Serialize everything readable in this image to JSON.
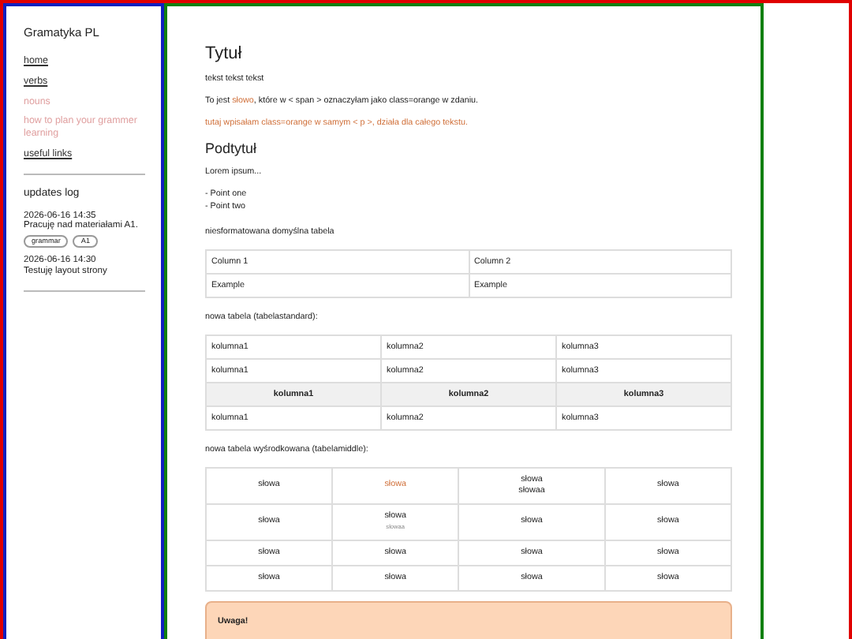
{
  "sidebar": {
    "site_title": "Gramatyka PL",
    "nav": [
      {
        "label": "home",
        "disabled": false
      },
      {
        "label": "verbs",
        "disabled": false
      },
      {
        "label": "nouns",
        "disabled": true
      },
      {
        "label": "how to plan your grammer learning",
        "disabled": true
      },
      {
        "label": "useful links",
        "disabled": false
      }
    ],
    "updates_title": "updates log",
    "updates": [
      {
        "time": "2026-06-16 14:35",
        "text": "Pracuję nad materiałami A1.",
        "tags": [
          "grammar",
          "A1"
        ]
      },
      {
        "time": "2026-06-16 14:30",
        "text": "Testuję layout strony"
      }
    ]
  },
  "main": {
    "title": "Tytuł",
    "paragraphs": [
      {
        "parts": [
          {
            "text": "tekst tekst tekst",
            "orange": false
          }
        ]
      },
      {
        "parts": [
          {
            "text": "To jest ",
            "orange": false
          },
          {
            "text": "słowo",
            "orange": true
          },
          {
            "text": ", które w < span > oznaczyłam jako class=orange w zdaniu.",
            "orange": false
          }
        ]
      },
      {
        "parts": [
          {
            "text": "tutaj wpisałam class=orange w samym < p >, działa dla całego tekstu.",
            "orange": true
          }
        ]
      }
    ],
    "subtitle": "Podtytuł",
    "lorem": "Lorem ipsum...",
    "points": [
      "- Point one",
      "- Point two"
    ],
    "table1_caption": "niesformatowana domyślna tabela",
    "table1": [
      [
        "Column 1",
        "Column 2"
      ],
      [
        "Example",
        "Example"
      ]
    ],
    "table2_caption": "nowa tabela (tabelastandard):",
    "table2": [
      {
        "kind": "normal",
        "cells": [
          "kolumna1",
          "kolumna2",
          "kolumna3"
        ]
      },
      {
        "kind": "normal",
        "cells": [
          "kolumna1",
          "kolumna2",
          "kolumna3"
        ]
      },
      {
        "kind": "header",
        "cells": [
          "kolumna1",
          "kolumna2",
          "kolumna3"
        ]
      },
      {
        "kind": "normal",
        "cells": [
          "kolumna1",
          "kolumna2",
          "kolumna3"
        ]
      }
    ],
    "table3_caption": "nowa tabela wyśrodkowana (tabelamiddle):",
    "table3": [
      [
        {
          "text": "słowa"
        },
        {
          "text": "słowa",
          "orange": true
        },
        {
          "text": "słowa",
          "second_line": "słowaa"
        },
        {
          "text": "słowa"
        }
      ],
      [
        {
          "text": "słowa"
        },
        {
          "text": "słowa",
          "note": "słowaa"
        },
        {
          "text": "słowa"
        },
        {
          "text": "słowa"
        }
      ],
      [
        {
          "text": "słowa"
        },
        {
          "text": "słowa"
        },
        {
          "text": "słowa"
        },
        {
          "text": "słowa"
        }
      ],
      [
        {
          "text": "słowa"
        },
        {
          "text": "słowa"
        },
        {
          "text": "słowa"
        },
        {
          "text": "słowa"
        }
      ]
    ],
    "notice_title": "Uwaga!"
  }
}
